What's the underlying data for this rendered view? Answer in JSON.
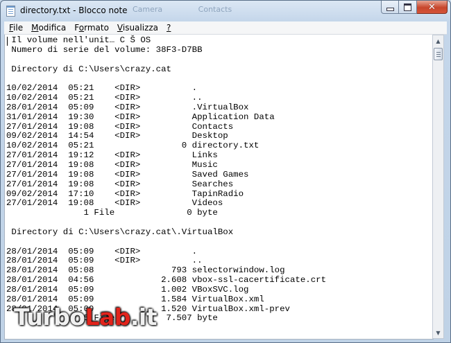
{
  "window": {
    "title": "directory.txt - Blocco note",
    "background_tabs": [
      "Camera",
      "Contacts"
    ]
  },
  "menu": [
    {
      "label": "File",
      "key": "F"
    },
    {
      "label": "Modifica",
      "key": "M"
    },
    {
      "label": "Formato",
      "key": "o"
    },
    {
      "label": "Visualizza",
      "key": "V"
    },
    {
      "label": "?",
      "key": "?"
    }
  ],
  "document": {
    "lines": [
      " Il volume nell'unit… C Š OS",
      " Numero di serie del volume: 38F3-D7BB",
      "",
      " Directory di C:\\Users\\crazy.cat",
      "",
      "10/02/2014  05:21    <DIR>          .",
      "10/02/2014  05:21    <DIR>          ..",
      "28/01/2014  05:09    <DIR>          .VirtualBox",
      "31/01/2014  19:30    <DIR>          Application Data",
      "27/01/2014  19:08    <DIR>          Contacts",
      "09/02/2014  14:54    <DIR>          Desktop",
      "10/02/2014  05:21                 0 directory.txt",
      "27/01/2014  19:12    <DIR>          Links",
      "27/01/2014  19:08    <DIR>          Music",
      "27/01/2014  19:08    <DIR>          Saved Games",
      "27/01/2014  19:08    <DIR>          Searches",
      "09/02/2014  17:10    <DIR>          TapinRadio",
      "27/01/2014  19:08    <DIR>          Videos",
      "               1 File              0 byte",
      "",
      " Directory di C:\\Users\\crazy.cat\\.VirtualBox",
      "",
      "28/01/2014  05:09    <DIR>          .",
      "28/01/2014  05:09    <DIR>          ..",
      "28/01/2014  05:08               793 selectorwindow.log",
      "28/01/2014  04:56             2.608 vbox-ssl-cacertificate.crt",
      "28/01/2014  05:09             1.002 VBoxSVC.log",
      "28/01/2014  05:09             1.584 VirtualBox.xml",
      "28/01/2014  05:09             1.520 VirtualBox.xml-prev",
      "               5 File          7.507 byte"
    ]
  },
  "watermark": {
    "part1": "Turbo",
    "part2": "Lab",
    "part3": ".it"
  },
  "icons": {
    "app": "notepad-icon",
    "minimize": "minimize-icon",
    "maximize": "maximize-icon",
    "close": "close-icon"
  }
}
